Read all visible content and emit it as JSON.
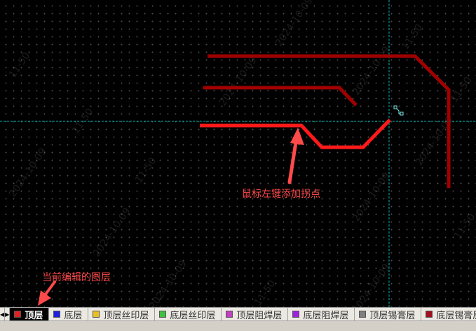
{
  "canvas": {
    "watermarks": [
      "11-50",
      "2024-10-09",
      "11-50",
      "2024-10-09",
      "11-50",
      "2024-10-09",
      "11-50",
      "2024-10-09",
      "11-50",
      "2024-10-09"
    ]
  },
  "annotations": {
    "click_hint": "鼠标左键添加拐点",
    "current_layer_hint": "当前编辑的图层",
    "color": "#ff4a4a"
  },
  "layer_bar": {
    "prev_icon": "triangle-left-icon",
    "next_icon": "triangle-right-icon",
    "layers": [
      {
        "label": "顶层",
        "color": "#e02020",
        "active": true
      },
      {
        "label": "底层",
        "color": "#2020e0",
        "active": false
      },
      {
        "label": "顶层丝印层",
        "color": "#e8c020",
        "active": false
      },
      {
        "label": "底层丝印层",
        "color": "#40c040",
        "active": false
      },
      {
        "label": "顶层阻焊层",
        "color": "#c040c0",
        "active": false
      },
      {
        "label": "底层阻焊层",
        "color": "#a020e0",
        "active": false
      },
      {
        "label": "顶层锡膏层",
        "color": "#808080",
        "active": false
      },
      {
        "label": "底层锡膏层",
        "color": "#a01020",
        "active": false
      }
    ]
  },
  "colors": {
    "trace_existing": "#a00000",
    "trace_active": "#ff1a1a",
    "crosshair": "#00b4b4",
    "arrow": "#ff4a4a"
  }
}
